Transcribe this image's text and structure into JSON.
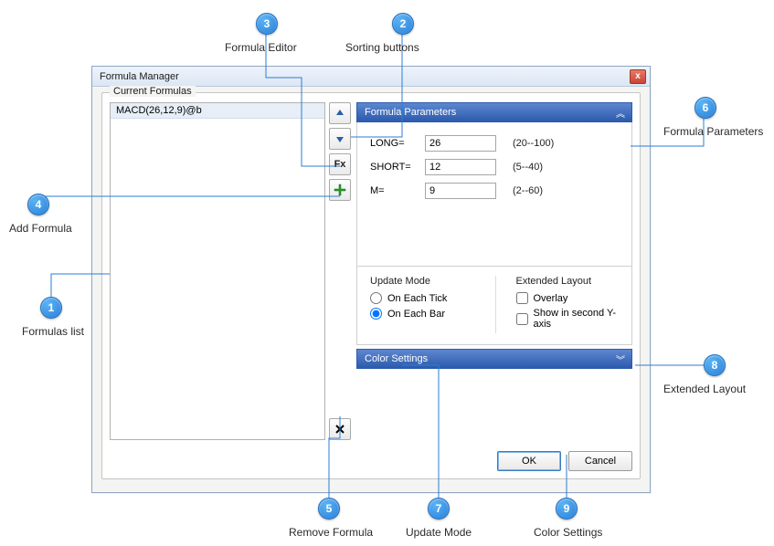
{
  "window": {
    "title": "Formula Manager",
    "close_icon": "x"
  },
  "group": {
    "title": "Current Formulas"
  },
  "formulas": {
    "items": [
      {
        "label": "MACD(26,12,9)@b"
      }
    ]
  },
  "toolbar": {
    "up_icon": "move-up",
    "down_icon": "move-down",
    "fx_label": "Fx",
    "add_icon": "+",
    "remove_icon": "✕"
  },
  "param_panel": {
    "title": "Formula Parameters",
    "collapse_icon": "︽",
    "rows": [
      {
        "name": "LONG=",
        "value": "26",
        "range": "(20--100)"
      },
      {
        "name": "SHORT=",
        "value": "12",
        "range": "(5--40)"
      },
      {
        "name": "M=",
        "value": "9",
        "range": "(2--60)"
      }
    ]
  },
  "update_mode": {
    "title": "Update Mode",
    "options": [
      {
        "label": "On Each Tick",
        "checked": false
      },
      {
        "label": "On Each Bar",
        "checked": true
      }
    ]
  },
  "extended_layout": {
    "title": "Extended Layout",
    "options": [
      {
        "label": "Overlay",
        "checked": false
      },
      {
        "label": "Show in second Y-axis",
        "checked": false
      }
    ]
  },
  "color_panel": {
    "title": "Color Settings",
    "expand_icon": "︾"
  },
  "buttons": {
    "ok": "OK",
    "cancel": "Cancel"
  },
  "callouts": {
    "1": "Formulas list",
    "2": "Sorting buttons",
    "3": "Formula Editor",
    "4": "Add Formula",
    "5": "Remove Formula",
    "6": "Formula Parameters",
    "7": "Update Mode",
    "8": "Extended Layout",
    "9": "Color Settings"
  }
}
